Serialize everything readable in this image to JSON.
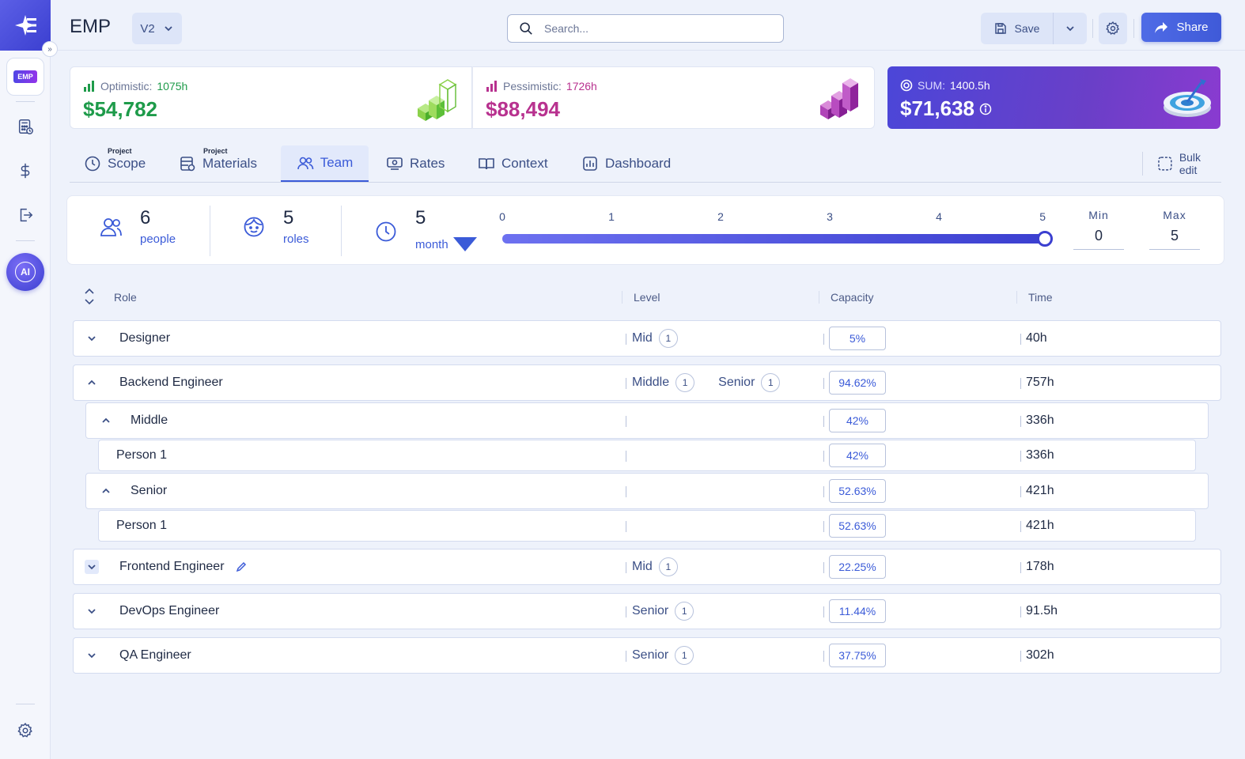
{
  "app": {
    "title": "EMP",
    "version": "V2",
    "project_badge": "EMP"
  },
  "search": {
    "placeholder": "Search..."
  },
  "toolbar": {
    "save_label": "Save",
    "share_label": "Share"
  },
  "summary": {
    "optimistic": {
      "label": "Optimistic:",
      "hours": "1075h",
      "value": "$54,782",
      "color": "#1e9b4a"
    },
    "pessimistic": {
      "label": "Pessimistic:",
      "hours": "1726h",
      "value": "$88,494",
      "color": "#b8328f"
    },
    "sum": {
      "label": "SUM:",
      "hours": "1400.5h",
      "value": "$71,638"
    }
  },
  "tabs": [
    {
      "label": "Scope",
      "tag": "Project"
    },
    {
      "label": "Materials",
      "tag": "Project"
    },
    {
      "label": "Team",
      "tag": ""
    },
    {
      "label": "Rates",
      "tag": ""
    },
    {
      "label": "Context",
      "tag": ""
    },
    {
      "label": "Dashboard",
      "tag": ""
    }
  ],
  "bulk_edit_label": "Bulk edit",
  "stats": {
    "people": {
      "value": "6",
      "unit": "people"
    },
    "roles": {
      "value": "5",
      "unit": "roles"
    },
    "duration": {
      "value": "5",
      "unit": "month"
    }
  },
  "slider": {
    "ticks": [
      "0",
      "1",
      "2",
      "3",
      "4",
      "5"
    ],
    "value": 5,
    "min_label": "Min",
    "min_value": "0",
    "max_label": "Max",
    "max_value": "5"
  },
  "table": {
    "headers": {
      "role": "Role",
      "level": "Level",
      "capacity": "Capacity",
      "time": "Time"
    },
    "rows": [
      {
        "role": "Designer",
        "levels": [
          {
            "name": "Mid",
            "count": "1"
          }
        ],
        "capacity": "5%",
        "time": "40h"
      },
      {
        "role": "Backend Engineer",
        "levels": [
          {
            "name": "Middle",
            "count": "1"
          },
          {
            "name": "Senior",
            "count": "1"
          }
        ],
        "capacity": "94.62%",
        "time": "757h"
      },
      {
        "role": "Middle",
        "levels": [],
        "capacity": "42%",
        "time": "336h"
      },
      {
        "role": "Person 1",
        "levels": [],
        "capacity": "42%",
        "time": "336h"
      },
      {
        "role": "Senior",
        "levels": [],
        "capacity": "52.63%",
        "time": "421h"
      },
      {
        "role": "Person 1",
        "levels": [],
        "capacity": "52.63%",
        "time": "421h"
      },
      {
        "role": "Frontend Engineer",
        "levels": [
          {
            "name": "Mid",
            "count": "1"
          }
        ],
        "capacity": "22.25%",
        "time": "178h"
      },
      {
        "role": "DevOps Engineer",
        "levels": [
          {
            "name": "Senior",
            "count": "1"
          }
        ],
        "capacity": "11.44%",
        "time": "91.5h"
      },
      {
        "role": "QA Engineer",
        "levels": [
          {
            "name": "Senior",
            "count": "1"
          }
        ],
        "capacity": "37.75%",
        "time": "302h"
      }
    ]
  },
  "colors": {
    "accent": "#3b5bd8",
    "sum_card": "#5b43d4"
  }
}
